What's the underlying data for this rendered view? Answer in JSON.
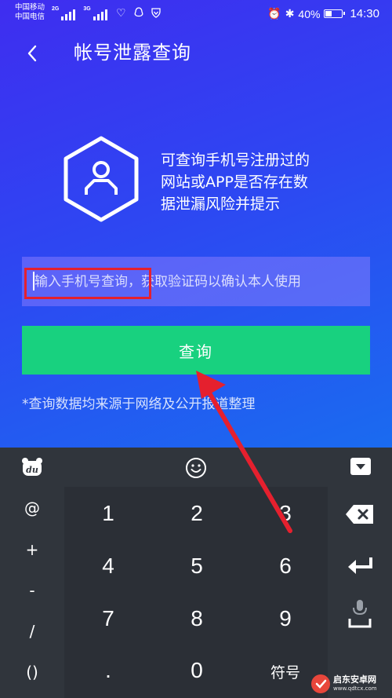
{
  "status_bar": {
    "carrier_1": "中国移动",
    "carrier_2": "中国电信",
    "net_1": "2G",
    "net_2": "3G",
    "battery_text": "40%",
    "battery_level": 0.4,
    "time": "14:30"
  },
  "header": {
    "title": "帐号泄露查询"
  },
  "intro": {
    "line_1": "可查询手机号注册过的",
    "line_2": "网站或APP是否存在数",
    "line_3": "据泄漏风险并提示"
  },
  "form": {
    "phone_placeholder": "输入手机号查询，获取验证码以确认本人使用",
    "phone_value": "",
    "query_label": "查询",
    "disclaimer": "*查询数据均来源于网络及公开报道整理"
  },
  "keyboard": {
    "symbols": [
      "@",
      "+",
      "-",
      "/",
      "()"
    ],
    "rows": [
      [
        "1",
        "2",
        "3"
      ],
      [
        "4",
        "5",
        "6"
      ],
      [
        "7",
        "8",
        "9"
      ],
      [
        ".",
        "0",
        "符号"
      ]
    ]
  },
  "watermark": {
    "name": "启东安卓网",
    "url": "www.qdtcx.com"
  },
  "colors": {
    "accent_green": "#18d17f",
    "highlight_red": "#e5202e",
    "keyboard_bg": "#2b2f36"
  },
  "icons": [
    "back-icon",
    "hexagon-user-icon",
    "du-logo-icon",
    "emoji-icon",
    "keyboard-collapse-icon",
    "backspace-icon",
    "enter-icon",
    "microphone-icon"
  ]
}
